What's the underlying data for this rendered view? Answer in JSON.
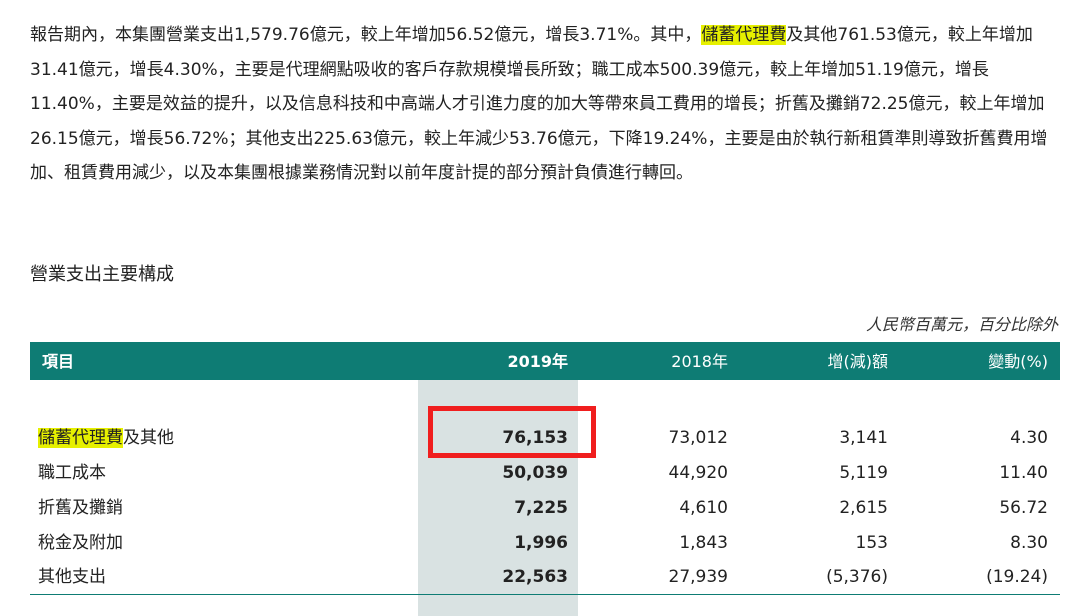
{
  "paragraph": {
    "part1": "報告期內，本集團營業支出1,579.76億元，較上年增加56.52億元，增長3.71%。其中，",
    "highlight": "儲蓄代理費",
    "part2": "及其他761.53億元，較上年增加31.41億元，增長4.30%，主要是代理網點吸收的客戶存款規模增長所致；職工成本500.39億元，較上年增加51.19億元，增長11.40%，主要是效益的提升，以及信息科技和中高端人才引進力度的加大等帶來員工費用的增長；折舊及攤銷72.25億元，較上年增加26.15億元，增長56.72%；其他支出225.63億元，較上年減少53.76億元，下降19.24%，主要是由於執行新租賃準則導致折舊費用增加、租賃費用減少，以及本集團根據業務情況對以前年度計提的部分預計負債進行轉回。"
  },
  "section": {
    "title": "營業支出主要構成",
    "unit_note": "人民幣百萬元，百分比除外"
  },
  "table": {
    "headers": {
      "item": "項目",
      "y2019": "2019年",
      "y2018": "2018年",
      "change": "增(減)額",
      "pct": "變動(%)"
    },
    "rows": [
      {
        "item_hl": "儲蓄代理費",
        "item_rest": "及其他",
        "y2019": "76,153",
        "y2018": "73,012",
        "change": "3,141",
        "pct": "4.30"
      },
      {
        "item_hl": "",
        "item_rest": "職工成本",
        "y2019": "50,039",
        "y2018": "44,920",
        "change": "5,119",
        "pct": "11.40"
      },
      {
        "item_hl": "",
        "item_rest": "折舊及攤銷",
        "y2019": "7,225",
        "y2018": "4,610",
        "change": "2,615",
        "pct": "56.72"
      },
      {
        "item_hl": "",
        "item_rest": "稅金及附加",
        "y2019": "1,996",
        "y2018": "1,843",
        "change": "153",
        "pct": "8.30"
      },
      {
        "item_hl": "",
        "item_rest": "其他支出",
        "y2019": "22,563",
        "y2018": "27,939",
        "change": "(5,376)",
        "pct": "(19.24)"
      }
    ]
  },
  "colors": {
    "header_bg": "#0e7c74",
    "highlight_text_bg": "#e6f000",
    "column_shade": "#d9e2e2",
    "annotation_box": "#f01e1e"
  }
}
